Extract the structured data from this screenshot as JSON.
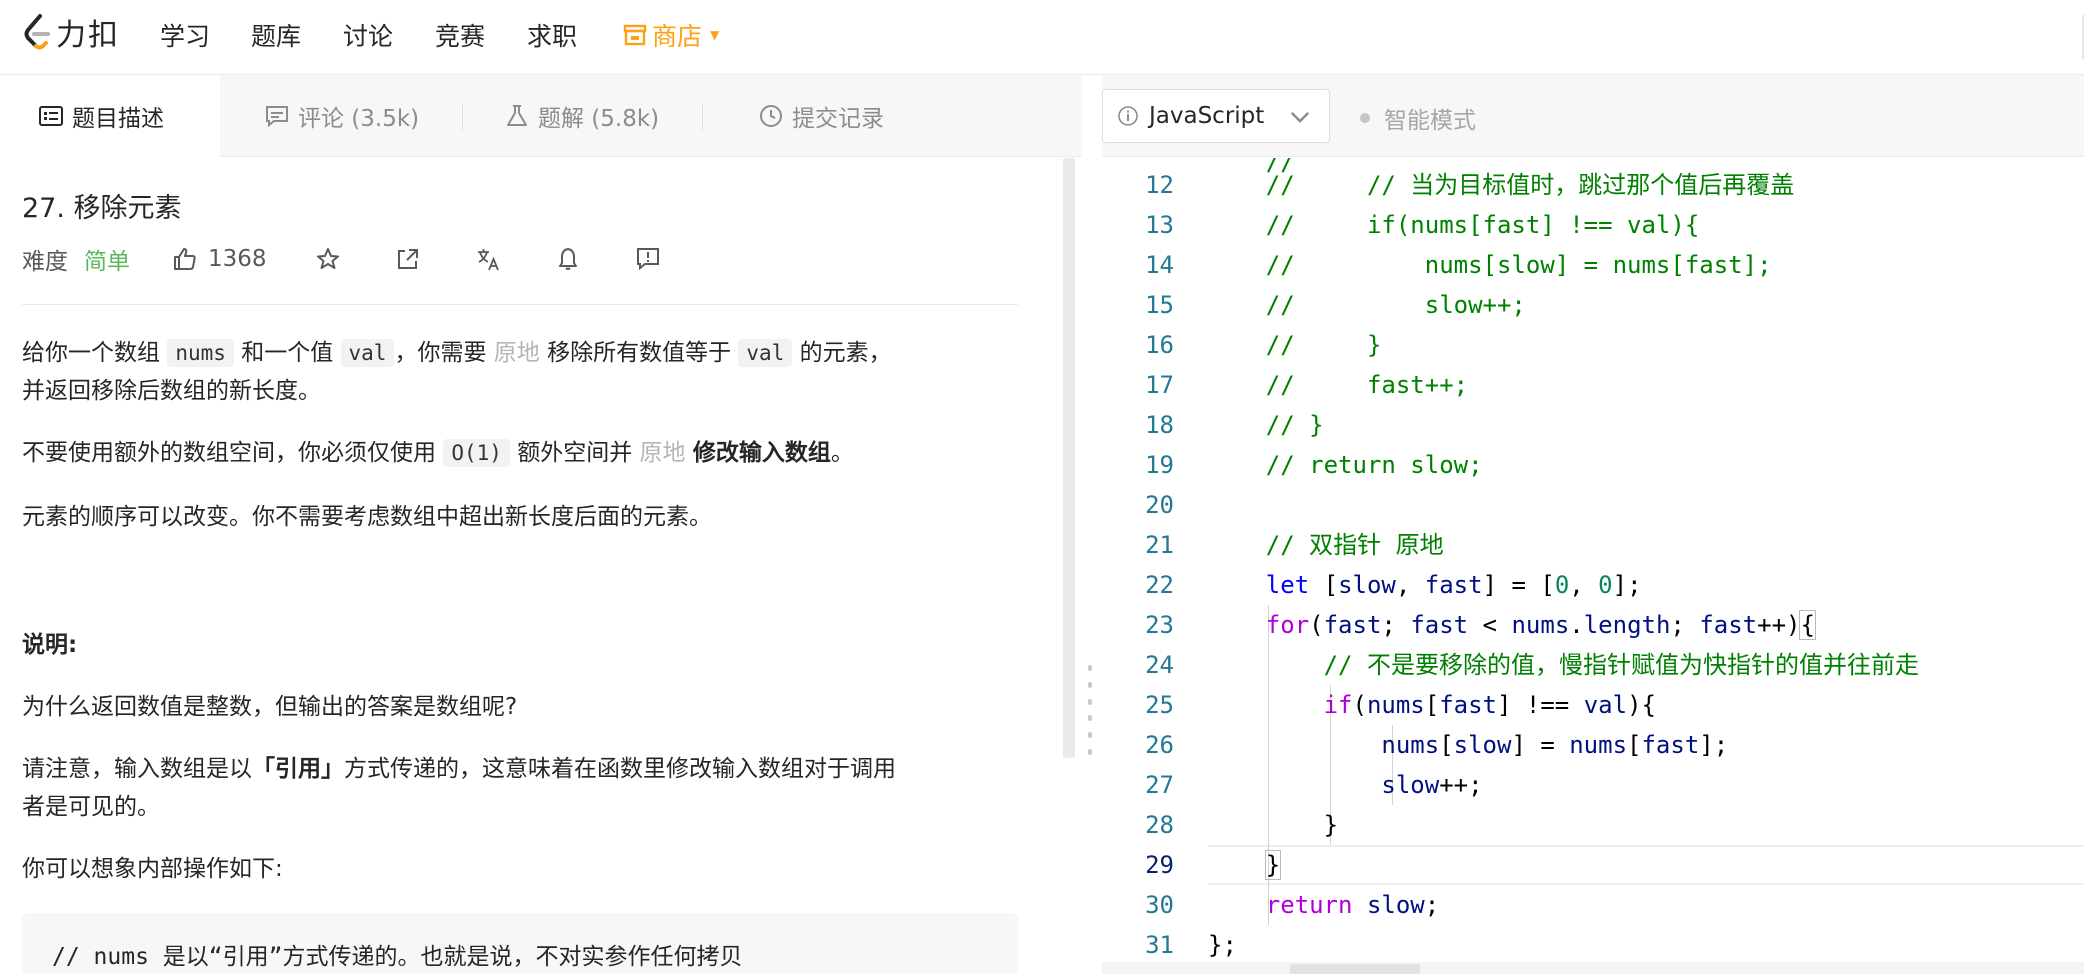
{
  "nav": {
    "logo_text": "力扣",
    "items": [
      "学习",
      "题库",
      "讨论",
      "竞赛",
      "求职"
    ],
    "store": "商店",
    "accent": "#ffa116"
  },
  "tabs": [
    {
      "label": "题目描述",
      "icon": "description-icon"
    },
    {
      "label": "评论 (3.5k)",
      "icon": "comment-icon"
    },
    {
      "label": "题解 (5.8k)",
      "icon": "flask-icon"
    },
    {
      "label": "提交记录",
      "icon": "clock-icon"
    }
  ],
  "problem": {
    "title": "27. 移除元素",
    "difficulty_label": "难度",
    "difficulty": "简单",
    "likes": "1368",
    "p1": {
      "a": "给你一个数组",
      "nums": "nums",
      "b": "和一个值",
      "val": "val",
      "c": "，你需要",
      "inplace": "原地",
      "d": "移除所有数值等于",
      "e": "的元素，",
      "f": "并返回移除后数组的新长度。"
    },
    "p2": {
      "a": "不要使用额外的数组空间，你必须仅使用",
      "o1": "O(1)",
      "b": "额外空间并",
      "inplace": "原地",
      "bold": "修改输入数组",
      "end": "。"
    },
    "p3": "元素的顺序可以改变。你不需要考虑数组中超出新长度后面的元素。",
    "note_title": "说明:",
    "p4": "为什么返回数值是整数，但输出的答案是数组呢?",
    "p5": {
      "a": "请注意，输入数组是以",
      "bold": "「引用」",
      "b": "方式传递的，这意味着在函数里修改输入数组对于调用",
      "c": "者是可见的。"
    },
    "p6": "你可以想象内部操作如下:",
    "code_comment": "// nums 是以“引用”方式传递的。也就是说，不对实参作任何拷贝"
  },
  "editor": {
    "language": "JavaScript",
    "smart_mode": "智能模式",
    "lines": [
      {
        "n": "12",
        "t": "    //     // 当为目标值时，跳过那个值后再覆盖"
      },
      {
        "n": "13",
        "t": "    //     if(nums[fast] !== val){"
      },
      {
        "n": "14",
        "t": "    //         nums[slow] = nums[fast];"
      },
      {
        "n": "15",
        "t": "    //         slow++;"
      },
      {
        "n": "16",
        "t": "    //     }"
      },
      {
        "n": "17",
        "t": "    //     fast++;"
      },
      {
        "n": "18",
        "t": "    // }"
      },
      {
        "n": "19",
        "t": "    // return slow;"
      },
      {
        "n": "20",
        "t": ""
      },
      {
        "n": "21",
        "t": "    // 双指针 原地"
      },
      {
        "n": "22",
        "t": "    let [slow, fast] = [0, 0];"
      },
      {
        "n": "23",
        "t": "    for(fast; fast < nums.length; fast++){"
      },
      {
        "n": "24",
        "t": "        // 不是要移除的值，慢指针赋值为快指针的值并往前走"
      },
      {
        "n": "25",
        "t": "        if(nums[fast] !== val){"
      },
      {
        "n": "26",
        "t": "            nums[slow] = nums[fast];"
      },
      {
        "n": "27",
        "t": "            slow++;"
      },
      {
        "n": "28",
        "t": "        }"
      },
      {
        "n": "29",
        "t": "    }"
      },
      {
        "n": "30",
        "t": "    return slow;"
      },
      {
        "n": "31",
        "t": "};"
      }
    ]
  }
}
